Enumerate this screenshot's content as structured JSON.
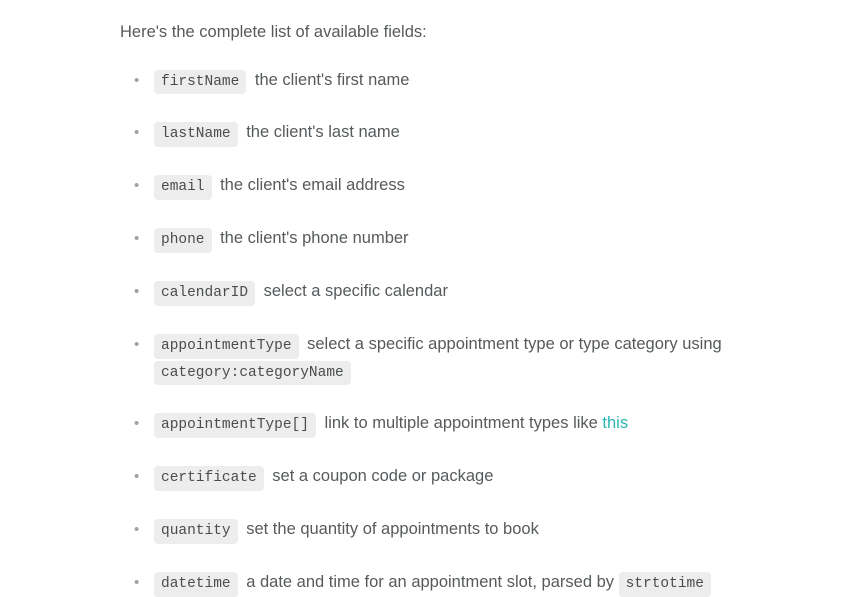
{
  "intro": "Here's the complete list of available fields:",
  "fields": [
    {
      "code": "firstName",
      "desc_before": " the client's first name"
    },
    {
      "code": "lastName",
      "desc_before": " the client's last name"
    },
    {
      "code": "email",
      "desc_before": " the client's email address"
    },
    {
      "code": "phone",
      "desc_before": " the client's phone number"
    },
    {
      "code": "calendarID",
      "desc_before": " select a specific calendar"
    },
    {
      "code": "appointmentType",
      "desc_before": " select a specific appointment type or type category using ",
      "code2": "category:categoryName"
    },
    {
      "code": "appointmentType[]",
      "desc_before": " link to multiple appointment types like ",
      "link": "this"
    },
    {
      "code": "certificate",
      "desc_before": " set a coupon code or package"
    },
    {
      "code": "quantity",
      "desc_before": " set the quantity of appointments to book"
    },
    {
      "code": "datetime",
      "desc_before": " a date and time for an appointment slot, parsed by ",
      "code2": "strtotime"
    }
  ]
}
